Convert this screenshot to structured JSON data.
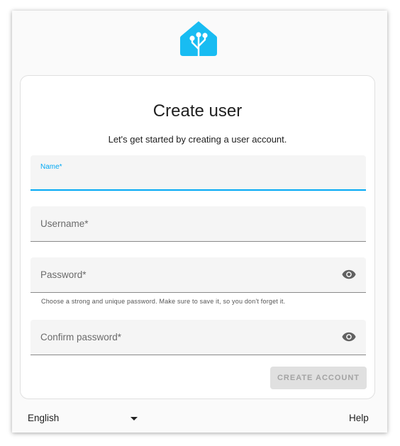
{
  "brand": {
    "logo_icon": "home-assistant-logo-icon",
    "accent_color": "#03a9f4",
    "logo_color": "#18bcf2"
  },
  "card": {
    "title": "Create user",
    "subtitle": "Let's get started by creating a user account."
  },
  "form": {
    "name": {
      "label": "Name*",
      "value": ""
    },
    "username": {
      "label": "Username*",
      "value": ""
    },
    "password": {
      "label": "Password*",
      "value": "",
      "icon": "eye-icon"
    },
    "password_helper": "Choose a strong and unique password. Make sure to save it, so you don't forget it.",
    "confirm_password": {
      "label": "Confirm password*",
      "value": "",
      "icon": "eye-icon"
    },
    "submit_label": "CREATE ACCOUNT",
    "submit_disabled": true
  },
  "footer": {
    "language": "English",
    "language_icon": "caret-down-icon",
    "help_label": "Help"
  }
}
